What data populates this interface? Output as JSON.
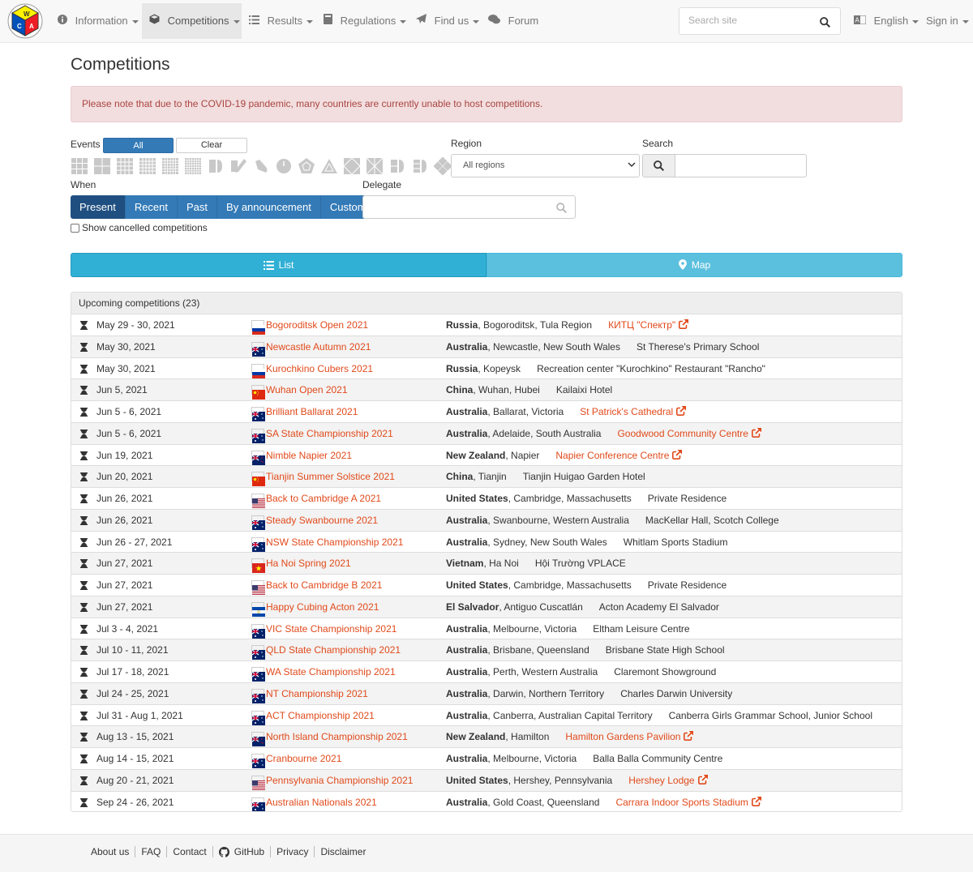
{
  "navbar": {
    "logo_letters": [
      "W",
      "C",
      "A"
    ],
    "items": [
      {
        "label": "Information",
        "icon": "info-icon",
        "caret": true,
        "active": false
      },
      {
        "label": "Competitions",
        "icon": "cube-icon",
        "caret": true,
        "active": true
      },
      {
        "label": "Results",
        "icon": "list-icon",
        "caret": true,
        "active": false
      },
      {
        "label": "Regulations",
        "icon": "book-icon",
        "caret": true,
        "active": false
      },
      {
        "label": "Find us",
        "icon": "paper-plane-icon",
        "caret": true,
        "active": false
      },
      {
        "label": "Forum",
        "icon": "comments-icon",
        "caret": false,
        "active": false
      }
    ],
    "search_placeholder": "Search site",
    "language": "English",
    "sign_in": "Sign in"
  },
  "page_title": "Competitions",
  "alert": "Please note that due to the COVID-19 pandemic, many countries are currently unable to host competitions.",
  "filters": {
    "events_label": "Events",
    "all_label": "All",
    "clear_label": "Clear",
    "events": [
      "3x3x3",
      "2x2x2",
      "4x4x4",
      "5x5x5",
      "6x6x6",
      "7x7x7",
      "3x3 Blindfolded",
      "3x3 Fewest Moves",
      "3x3 One-Handed",
      "Clock",
      "Megaminx",
      "Pyraminx",
      "Skewb",
      "Square-1",
      "4x4 Blindfolded",
      "5x5 Blindfolded",
      "3x3 Multi-Blind"
    ],
    "region_label": "Region",
    "region_value": "All regions",
    "search_label": "Search",
    "when_label": "When",
    "when_options": [
      "Present",
      "Recent",
      "Past",
      "By announcement",
      "Custom"
    ],
    "when_selected": "Present",
    "delegate_label": "Delegate",
    "show_cancelled": "Show cancelled competitions"
  },
  "tabs": {
    "list": "List",
    "map": "Map"
  },
  "table": {
    "heading": "Upcoming competitions (23)",
    "rows": [
      {
        "date": "May 29 - 30, 2021",
        "flag": "ru",
        "name": "Bogoroditsk Open 2021",
        "country": "Russia",
        "city": ", Bogoroditsk, Tula Region",
        "venue": "КИТЦ \"Спектр\"",
        "venue_link": true
      },
      {
        "date": "May 30, 2021",
        "flag": "au",
        "name": "Newcastle Autumn 2021",
        "country": "Australia",
        "city": ", Newcastle, New South Wales",
        "venue": "St Therese's Primary School",
        "venue_link": false
      },
      {
        "date": "May 30, 2021",
        "flag": "ru",
        "name": "Kurochkino Cubers 2021",
        "country": "Russia",
        "city": ", Kopeysk",
        "venue": "Recreation center \"Kurochkino\" Restaurant \"Rancho\"",
        "venue_link": false
      },
      {
        "date": "Jun 5, 2021",
        "flag": "cn",
        "name": "Wuhan Open 2021",
        "country": "China",
        "city": ", Wuhan, Hubei",
        "venue": "Kailaixi Hotel",
        "venue_link": false
      },
      {
        "date": "Jun 5 - 6, 2021",
        "flag": "au",
        "name": "Brilliant Ballarat 2021",
        "country": "Australia",
        "city": ", Ballarat, Victoria",
        "venue": "St Patrick's Cathedral",
        "venue_link": true
      },
      {
        "date": "Jun 5 - 6, 2021",
        "flag": "au",
        "name": "SA State Championship 2021",
        "country": "Australia",
        "city": ", Adelaide, South Australia",
        "venue": "Goodwood Community Centre",
        "venue_link": true
      },
      {
        "date": "Jun 19, 2021",
        "flag": "nz",
        "name": "Nimble Napier 2021",
        "country": "New Zealand",
        "city": ", Napier",
        "venue": "Napier Conference Centre",
        "venue_link": true
      },
      {
        "date": "Jun 20, 2021",
        "flag": "cn",
        "name": "Tianjin Summer Solstice 2021",
        "country": "China",
        "city": ", Tianjin",
        "venue": "Tianjin Huigao Garden Hotel",
        "venue_link": false
      },
      {
        "date": "Jun 26, 2021",
        "flag": "us",
        "name": "Back to Cambridge A 2021",
        "country": "United States",
        "city": ", Cambridge, Massachusetts",
        "venue": "Private Residence",
        "venue_link": false
      },
      {
        "date": "Jun 26, 2021",
        "flag": "au",
        "name": "Steady Swanbourne 2021",
        "country": "Australia",
        "city": ", Swanbourne, Western Australia",
        "venue": "MacKellar Hall, Scotch College",
        "venue_link": false
      },
      {
        "date": "Jun 26 - 27, 2021",
        "flag": "au",
        "name": "NSW State Championship 2021",
        "country": "Australia",
        "city": ", Sydney, New South Wales",
        "venue": "Whitlam Sports Stadium",
        "venue_link": false
      },
      {
        "date": "Jun 27, 2021",
        "flag": "vn",
        "name": "Ha Noi Spring 2021",
        "country": "Vietnam",
        "city": ", Ha Noi",
        "venue": "Hội Trường VPLACE",
        "venue_link": false
      },
      {
        "date": "Jun 27, 2021",
        "flag": "us",
        "name": "Back to Cambridge B 2021",
        "country": "United States",
        "city": ", Cambridge, Massachusetts",
        "venue": "Private Residence",
        "venue_link": false
      },
      {
        "date": "Jun 27, 2021",
        "flag": "sv",
        "name": "Happy Cubing Acton 2021",
        "country": "El Salvador",
        "city": ", Antiguo Cuscatlán",
        "venue": "Acton Academy El Salvador",
        "venue_link": false
      },
      {
        "date": "Jul 3 - 4, 2021",
        "flag": "au",
        "name": "VIC State Championship 2021",
        "country": "Australia",
        "city": ", Melbourne, Victoria",
        "venue": "Eltham Leisure Centre",
        "venue_link": false
      },
      {
        "date": "Jul 10 - 11, 2021",
        "flag": "au",
        "name": "QLD State Championship 2021",
        "country": "Australia",
        "city": ", Brisbane, Queensland",
        "venue": "Brisbane State High School",
        "venue_link": false
      },
      {
        "date": "Jul 17 - 18, 2021",
        "flag": "au",
        "name": "WA State Championship 2021",
        "country": "Australia",
        "city": ", Perth, Western Australia",
        "venue": "Claremont Showground",
        "venue_link": false
      },
      {
        "date": "Jul 24 - 25, 2021",
        "flag": "au",
        "name": "NT Championship 2021",
        "country": "Australia",
        "city": ", Darwin, Northern Territory",
        "venue": "Charles Darwin University",
        "venue_link": false
      },
      {
        "date": "Jul 31 - Aug 1, 2021",
        "flag": "au",
        "name": "ACT Championship 2021",
        "country": "Australia",
        "city": ", Canberra, Australian Capital Territory",
        "venue": "Canberra Girls Grammar School, Junior School",
        "venue_link": false
      },
      {
        "date": "Aug 13 - 15, 2021",
        "flag": "nz",
        "name": "North Island Championship 2021",
        "country": "New Zealand",
        "city": ", Hamilton",
        "venue": "Hamilton Gardens Pavilion",
        "venue_link": true
      },
      {
        "date": "Aug 14 - 15, 2021",
        "flag": "au",
        "name": "Cranbourne 2021",
        "country": "Australia",
        "city": ", Melbourne, Victoria",
        "venue": "Balla Balla Community Centre",
        "venue_link": false
      },
      {
        "date": "Aug 20 - 21, 2021",
        "flag": "us",
        "name": "Pennsylvania Championship 2021",
        "country": "United States",
        "city": ", Hershey, Pennsylvania",
        "venue": "Hershey Lodge",
        "venue_link": true
      },
      {
        "date": "Sep 24 - 26, 2021",
        "flag": "au",
        "name": "Australian Nationals 2021",
        "country": "Australia",
        "city": ", Gold Coast, Queensland",
        "venue": "Carrara Indoor Sports Stadium",
        "venue_link": true
      }
    ]
  },
  "footer": {
    "links": [
      "About us",
      "FAQ",
      "Contact",
      "GitHub",
      "Privacy",
      "Disclaimer"
    ]
  },
  "colors": {
    "link": "#e14a1b",
    "primary": "#337ab7",
    "info": "#5bc0de"
  }
}
